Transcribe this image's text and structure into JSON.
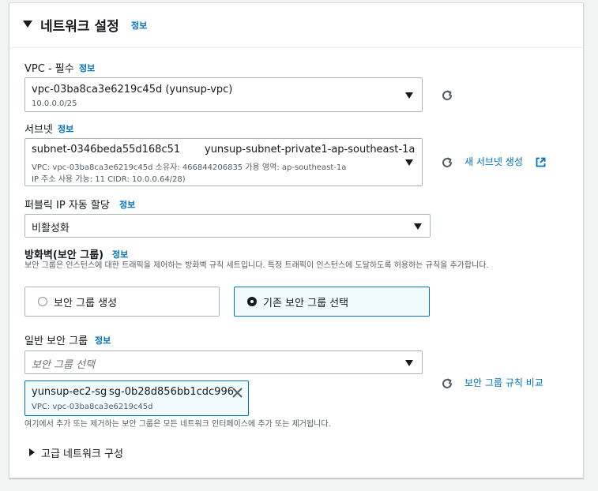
{
  "section": {
    "title": "네트워크 설정",
    "info": "정보"
  },
  "vpc": {
    "label": "VPC - 필수",
    "info": "정보",
    "value": "vpc-03ba8ca3e6219c45d (yunsup-vpc)",
    "sub": "10.0.0.0/25"
  },
  "subnet": {
    "label": "서브넷",
    "info": "정보",
    "id": "subnet-0346beda55d168c51",
    "name": "yunsup-subnet-private1-ap-southeast-1a",
    "sub1": "VPC: vpc-03ba8ca3e6219c45d     소유자: 466844206835     가용 영역: ap-southeast-1a",
    "sub2": "IP 주소 사용 가능: 11     CIDR: 10.0.0.64/28)",
    "create_link": "새 서브넷 생성"
  },
  "public_ip": {
    "label": "퍼블릭 IP 자동 할당",
    "info": "정보",
    "value": "비활성화"
  },
  "firewall": {
    "label": "방화벽(보안 그룹)",
    "info": "정보",
    "description": "보안 그룹은 인스턴스에 대한 트래픽을 제어하는 방화벽 규칙 세트입니다. 특정 트래픽이 인스턴스에 도달하도록 허용하는 규칙을 추가합니다.",
    "option_create": "보안 그룹 생성",
    "option_existing": "기존 보안 그룹 선택"
  },
  "sg": {
    "label": "일반 보안 그룹",
    "info": "정보",
    "placeholder": "보안 그룹 선택",
    "compare_link": "보안 그룹 규칙 비교",
    "token_name": "yunsup-ec2-sg",
    "token_id": "sg-0b28d856bb1cdc996",
    "token_vpc": "VPC: vpc-03ba8ca3e6219c45d",
    "note": "여기에서 추가 또는 제거하는 보안 그룹은 모든 네트워크 인터페이스에 추가 또는 제거됩니다."
  },
  "advanced": {
    "label": "고급 네트워크 구성"
  },
  "colors": {
    "link": "#0073bb",
    "border": "#aab7b8",
    "selected_bg": "#f1faff"
  }
}
